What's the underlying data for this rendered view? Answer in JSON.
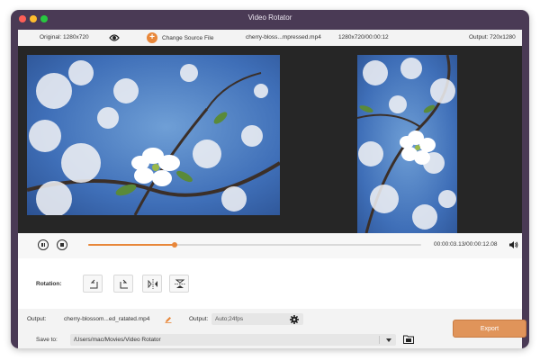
{
  "window": {
    "title": "Video Rotator",
    "colors": {
      "accent": "#e8873a",
      "frame": "#4a3a55",
      "export": "#e0945a"
    }
  },
  "info_bar": {
    "original": "Original: 1280x720",
    "change_source": "Change Source File",
    "file_name": "cherry-bloss...mpressed.mp4",
    "file_meta": "1280x720/00:00:12",
    "output": "Output: 720x1280"
  },
  "playback": {
    "progress": 0.26,
    "time": "00:00:03.13/00:00:12.08"
  },
  "rotation": {
    "label": "Rotation:",
    "buttons": [
      "rotate-left-icon",
      "rotate-right-icon",
      "flip-horizontal-icon",
      "flip-vertical-icon"
    ]
  },
  "output": {
    "file_label": "Output:",
    "file_name": "cherry-blossom...ed_ratated.mp4",
    "format_label": "Output:",
    "format_value": "Auto;24fps",
    "save_label": "Save to:",
    "save_path": "/Users/mac/Movies/Video Rotator",
    "export_label": "Export"
  }
}
